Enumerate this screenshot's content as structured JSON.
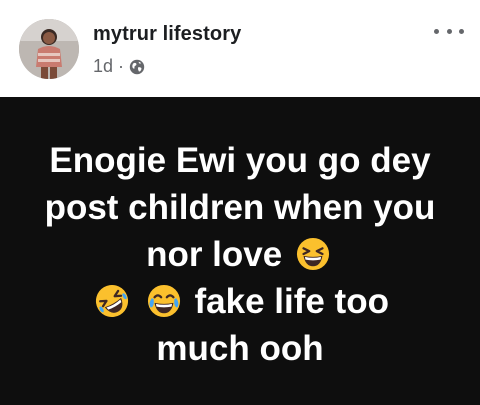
{
  "post": {
    "author": "mytrur lifestory",
    "time": "1d",
    "separator": "·",
    "privacy_icon": "globe-icon",
    "menu_icon": "more-options-icon"
  },
  "content": {
    "text_line1": "Enogie Ewi you go dey post children when you nor love",
    "text_line2": "fake life too much ooh",
    "emojis": [
      "grinning-squinting-face",
      "rolling-on-floor-laughing-face",
      "tears-of-joy-face"
    ]
  },
  "colors": {
    "post_background": "#0e0e0e",
    "post_text": "#ffffff",
    "author_text": "#1c1e21",
    "meta_text": "#65676b",
    "emoji_yellow": "#fbc02d"
  }
}
